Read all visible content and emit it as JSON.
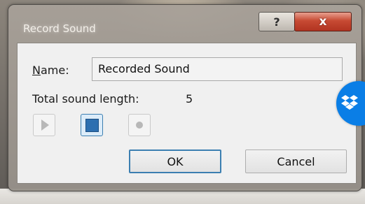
{
  "window": {
    "title": "Record Sound",
    "help_glyph": "?",
    "close_glyph": "x"
  },
  "form": {
    "name_label_mnemonic": "N",
    "name_label_rest": "ame:",
    "name_value": "Recorded Sound",
    "length_label": "Total sound length:",
    "length_value": "5"
  },
  "controls": {
    "play_icon": "play-icon",
    "stop_icon": "stop-icon",
    "record_icon": "record-icon"
  },
  "buttons": {
    "ok_label": "OK",
    "cancel_label": "Cancel"
  },
  "colors": {
    "close_button": "#c74a33",
    "accent_blue": "#2d6fb0",
    "dropbox_blue": "#0a7ee6"
  }
}
